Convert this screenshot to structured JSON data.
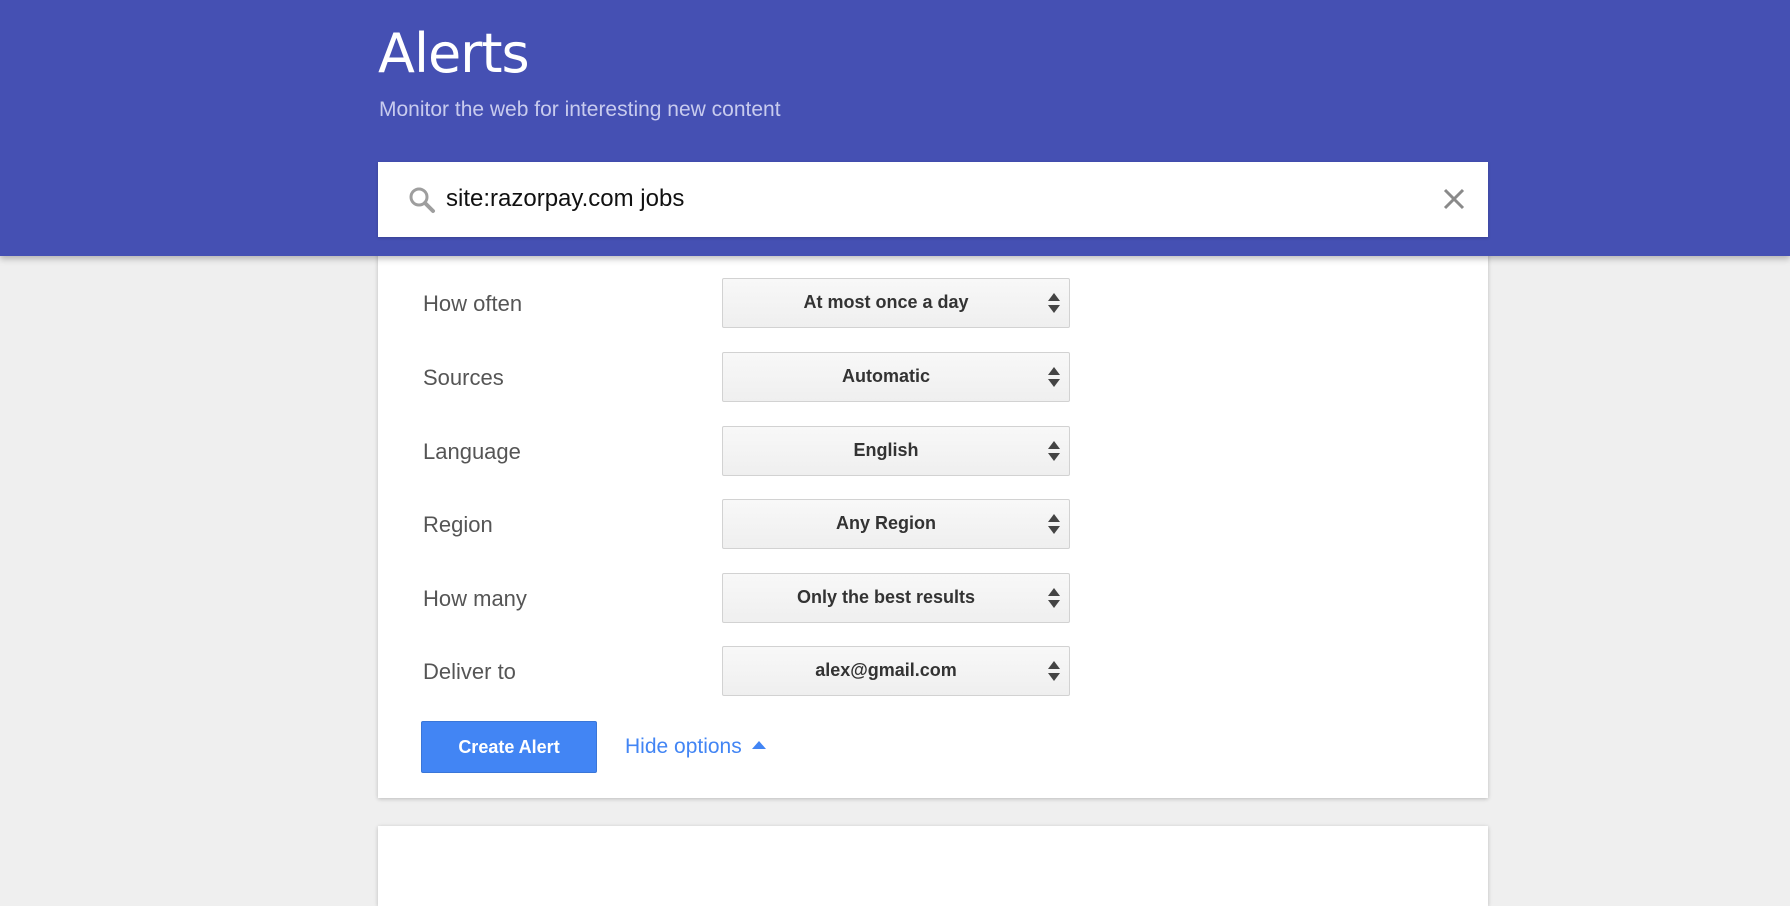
{
  "header": {
    "title": "Alerts",
    "subtitle": "Monitor the web for interesting new content",
    "background_color": "#4550b3"
  },
  "search": {
    "value": "site:razorpay.com jobs",
    "icon": "search-icon",
    "clear_icon": "close-icon"
  },
  "options": [
    {
      "label": "How often",
      "value": "At most once a day"
    },
    {
      "label": "Sources",
      "value": "Automatic"
    },
    {
      "label": "Language",
      "value": "English"
    },
    {
      "label": "Region",
      "value": "Any Region"
    },
    {
      "label": "How many",
      "value": "Only the best results"
    },
    {
      "label": "Deliver to",
      "value": "alex@gmail.com"
    }
  ],
  "actions": {
    "create_label": "Create Alert",
    "hide_options_label": "Hide options",
    "accent_color": "#4285f4"
  }
}
